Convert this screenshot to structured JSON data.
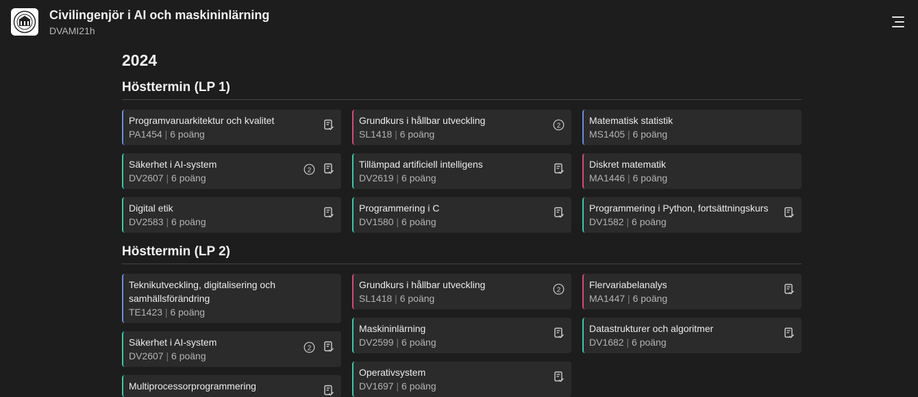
{
  "header": {
    "title": "Civilingenjör i AI och maskininlärning",
    "subtitle": "DVAMI21h",
    "logo_icon": "university-seal-logo",
    "menu_icon": "hamburger-menu-icon"
  },
  "year": "2024",
  "terms": [
    {
      "heading": "Hösttermin (LP 1)",
      "courses": [
        {
          "name": "Programvaruarkitektur och kvalitet",
          "code": "PA1454",
          "points": "6 poäng",
          "accent": "blue",
          "icons": [
            "document-check-icon"
          ]
        },
        {
          "name": "Grundkurs i hållbar utveckling",
          "code": "SL1418",
          "points": "6 poäng",
          "accent": "pink",
          "icons": [
            "circled-two-icon"
          ]
        },
        {
          "name": "Matematisk statistik",
          "code": "MS1405",
          "points": "6 poäng",
          "accent": "blue",
          "icons": []
        },
        {
          "name": "Säkerhet i AI-system",
          "code": "DV2607",
          "points": "6 poäng",
          "accent": "green",
          "icons": [
            "circled-two-icon",
            "document-check-icon"
          ]
        },
        {
          "name": "Tillämpad artificiell intelligens",
          "code": "DV2619",
          "points": "6 poäng",
          "accent": "green",
          "icons": [
            "document-check-icon"
          ]
        },
        {
          "name": "Diskret matematik",
          "code": "MA1446",
          "points": "6 poäng",
          "accent": "pink",
          "icons": []
        },
        {
          "name": "Digital etik",
          "code": "DV2583",
          "points": "6 poäng",
          "accent": "green",
          "icons": [
            "document-check-icon"
          ]
        },
        {
          "name": "Programmering i C",
          "code": "DV1580",
          "points": "6 poäng",
          "accent": "green",
          "icons": [
            "document-check-icon"
          ]
        },
        {
          "name": "Programmering i Python, fortsättningskurs",
          "code": "DV1582",
          "points": "6 poäng",
          "accent": "green",
          "icons": [
            "document-check-icon"
          ]
        }
      ]
    },
    {
      "heading": "Hösttermin (LP 2)",
      "courses": [
        {
          "name": "Teknikutveckling, digitalisering och samhällsförändring",
          "code": "TE1423",
          "points": "6 poäng",
          "accent": "blue",
          "icons": []
        },
        {
          "name": "Grundkurs i hållbar utveckling",
          "code": "SL1418",
          "points": "6 poäng",
          "accent": "pink",
          "icons": [
            "circled-two-icon"
          ]
        },
        {
          "name": "Flervariabelanalys",
          "code": "MA1447",
          "points": "6 poäng",
          "accent": "pink",
          "icons": [
            "document-check-icon"
          ]
        },
        {
          "name": "Säkerhet i AI-system",
          "code": "DV2607",
          "points": "6 poäng",
          "accent": "green",
          "icons": [
            "circled-two-icon",
            "document-check-icon"
          ]
        },
        {
          "name": "Maskininlärning",
          "code": "DV2599",
          "points": "6 poäng",
          "accent": "green",
          "icons": [
            "document-check-icon"
          ]
        },
        {
          "name": "Datastrukturer och algoritmer",
          "code": "DV1682",
          "points": "6 poäng",
          "accent": "green",
          "icons": [
            "document-check-icon"
          ]
        },
        {
          "name": "Multiprocessorprogrammering",
          "code": "",
          "points": "",
          "accent": "green",
          "icons": [
            "document-check-icon"
          ]
        },
        {
          "name": "Operativsystem",
          "code": "DV1697",
          "points": "6 poäng",
          "accent": "green",
          "icons": [
            "document-check-icon"
          ]
        }
      ]
    }
  ],
  "colors": {
    "background": "#1d1d1d",
    "card": "#2b2b2b",
    "accent_blue": "#6b8fd6",
    "accent_green": "#3fc8a8",
    "accent_pink": "#d64a7a"
  }
}
